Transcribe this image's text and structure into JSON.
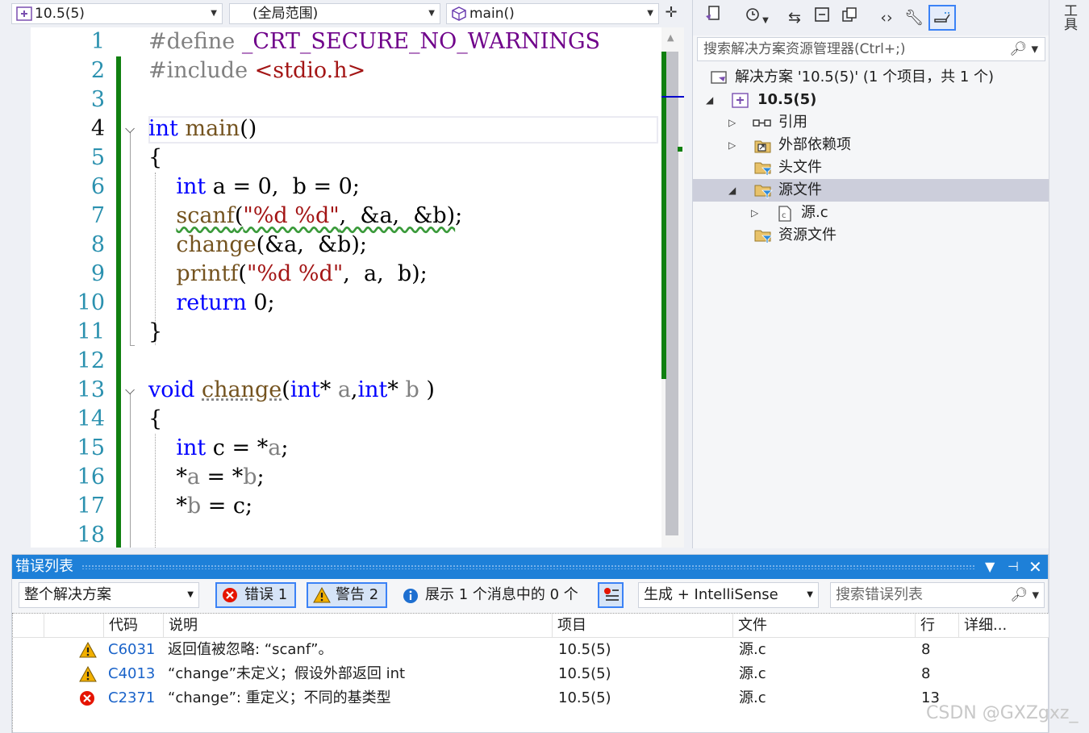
{
  "navbar": {
    "project_combo": "10.5(5)",
    "scope_combo": "(全局范围)",
    "member_combo": "main()"
  },
  "editor": {
    "lines": [
      {
        "n": "1",
        "html": "<span class=\"pp\">#define </span><span class=\"mc\">_CRT_SECURE_NO_WARNINGS</span>"
      },
      {
        "n": "2",
        "html": "<span class=\"pp\">#include </span><span class=\"incl\">&lt;stdio.h&gt;</span>"
      },
      {
        "n": "3",
        "html": ""
      },
      {
        "n": "4",
        "html": "<span class=\"kw\">int</span> <span class=\"fn\">main</span>()"
      },
      {
        "n": "5",
        "html": "{"
      },
      {
        "n": "6",
        "html": "    <span class=\"kw\">int</span> a = 0,  b = 0;"
      },
      {
        "n": "7",
        "html": "    <span class=\"wavy\"><span class=\"fn\">scanf</span>(<span class=\"str\">\"%d %d\"</span>,  &amp;a,  &amp;b)</span>;"
      },
      {
        "n": "8",
        "html": "    <span class=\"fn\">change</span>(&amp;a,  &amp;b);"
      },
      {
        "n": "9",
        "html": "    <span class=\"fn\">printf</span>(<span class=\"str\">\"%d %d\"</span>,  a,  b);"
      },
      {
        "n": "10",
        "html": "    <span class=\"kw\">return</span> 0;"
      },
      {
        "n": "11",
        "html": "}"
      },
      {
        "n": "12",
        "html": ""
      },
      {
        "n": "13",
        "html": "<span class=\"kw\">void</span> <span class=\"fnu\">change</span>(<span class=\"kw\">int</span>* <span class=\"prm\">a</span>,<span class=\"kw\">int</span>* <span class=\"prm\">b</span> )"
      },
      {
        "n": "14",
        "html": "{"
      },
      {
        "n": "15",
        "html": "    <span class=\"kw\">int</span> c = *<span class=\"prm\">a</span>;"
      },
      {
        "n": "16",
        "html": "    *<span class=\"prm\">a</span> = *<span class=\"prm\">b</span>;"
      },
      {
        "n": "17",
        "html": "    *<span class=\"prm\">b</span> = c;"
      },
      {
        "n": "18",
        "html": ""
      }
    ]
  },
  "solution_explorer": {
    "search_placeholder": "搜索解决方案资源管理器(Ctrl+;)",
    "tree": [
      {
        "label": "解决方案 '10.5(5)' (1 个项目，共 1 个)",
        "icon": "solution-icon"
      },
      {
        "label": "10.5(5)",
        "icon": "project-icon"
      },
      {
        "label": "引用",
        "icon": "references-icon"
      },
      {
        "label": "外部依赖项",
        "icon": "external-deps-icon"
      },
      {
        "label": "头文件",
        "icon": "filter-folder-icon"
      },
      {
        "label": "源文件",
        "icon": "filter-folder-icon"
      },
      {
        "label": "源.c",
        "icon": "c-file-icon"
      },
      {
        "label": "资源文件",
        "icon": "filter-folder-icon"
      }
    ]
  },
  "right_strip": {
    "label": "工具"
  },
  "error_list": {
    "title": "错误列表",
    "scope": "整个解决方案",
    "errors_btn": "错误 1",
    "warnings_btn": "警告 2",
    "messages_text": "展示 1 个消息中的 0 个",
    "source_combo": "生成 + IntelliSense",
    "search_placeholder": "搜索错误列表",
    "columns": {
      "code": "代码",
      "desc": "说明",
      "project": "项目",
      "file": "文件",
      "line": "行",
      "detail": "详细..."
    },
    "rows": [
      {
        "type": "warning",
        "code": "C6031",
        "desc": "返回值被忽略: “scanf”。",
        "project": "10.5(5)",
        "file": "源.c",
        "line": "8"
      },
      {
        "type": "warning",
        "code": "C4013",
        "desc": "“change”未定义；假设外部返回 int",
        "project": "10.5(5)",
        "file": "源.c",
        "line": "8"
      },
      {
        "type": "error",
        "code": "C2371",
        "desc": "“change”: 重定义；不同的基类型",
        "project": "10.5(5)",
        "file": "源.c",
        "line": "13"
      }
    ]
  },
  "watermark": "CSDN @GXZgxz_",
  "colors": {
    "accent": "#1e80d8",
    "change_bar": "#108010",
    "keyword": "#0000ff",
    "string": "#a31515",
    "function": "#74531f",
    "macro": "#6f008a",
    "line_number": "#2b91af"
  }
}
